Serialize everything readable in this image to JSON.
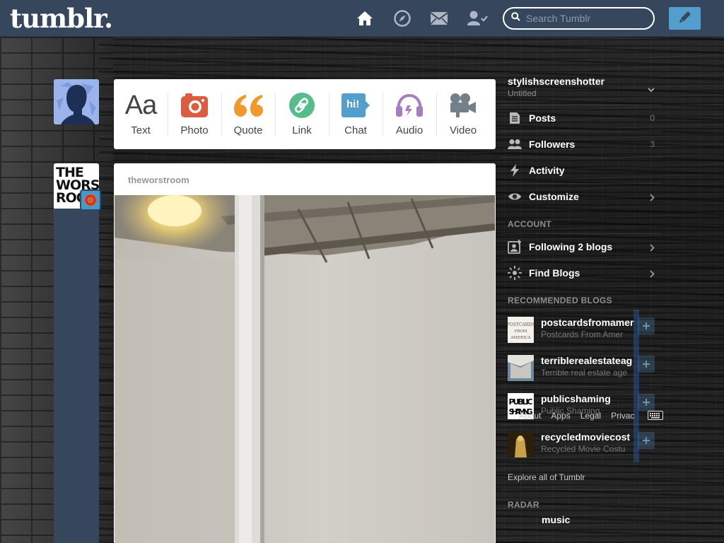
{
  "topbar": {
    "logo": "tumblr.",
    "search_placeholder": "Search Tumblr",
    "icons": [
      "home-icon",
      "explore-icon",
      "inbox-icon",
      "account-icon",
      "compose-icon"
    ],
    "accent": "#529ecc",
    "bar_color": "#36465d"
  },
  "composer": {
    "items": [
      {
        "label": "Text",
        "icon": "Aa"
      },
      {
        "label": "Photo",
        "icon": "camera-icon"
      },
      {
        "label": "Quote",
        "icon": "quote-icon"
      },
      {
        "label": "Link",
        "icon": "link-icon"
      },
      {
        "label": "Chat",
        "icon": "hi!"
      },
      {
        "label": "Audio",
        "icon": "headphones-icon"
      },
      {
        "label": "Video",
        "icon": "video-camera-icon"
      }
    ]
  },
  "post": {
    "blog_name": "theworstroom",
    "avatar_text": "THE WORST ROO"
  },
  "sidebar": {
    "blog_name": "stylishscreenshotter",
    "blog_title": "Untitled",
    "menu": [
      {
        "label": "Posts",
        "count": "0",
        "icon": "posts-icon"
      },
      {
        "label": "Followers",
        "count": "3",
        "icon": "followers-icon"
      },
      {
        "label": "Activity",
        "icon": "activity-icon"
      },
      {
        "label": "Customize",
        "icon": "eye-icon"
      }
    ],
    "account_title": "ACCOUNT",
    "account": [
      {
        "label": "Following 2 blogs",
        "icon": "following-icon"
      },
      {
        "label": "Find Blogs",
        "icon": "find-blogs-icon"
      }
    ],
    "recommended_title": "RECOMMENDED BLOGS",
    "recommended": [
      {
        "name": "postcardsfromamer",
        "sub": "Postcards From Amer",
        "thumb": "POSTCARDS FROM AMERICA"
      },
      {
        "name": "terriblerealestateag",
        "sub": "Terrible real estate age"
      },
      {
        "name": "publicshaming",
        "sub": "Public Shaming",
        "thumb": "PUBLIC SHAMING"
      },
      {
        "name": "recycledmoviecost",
        "sub": "Recycled Movie Costu"
      }
    ],
    "footer_links": [
      "About",
      "Apps",
      "Legal",
      "Privac"
    ],
    "explore": "Explore all of Tumblr",
    "radar_title": "RADAR",
    "radar_item": "music"
  }
}
